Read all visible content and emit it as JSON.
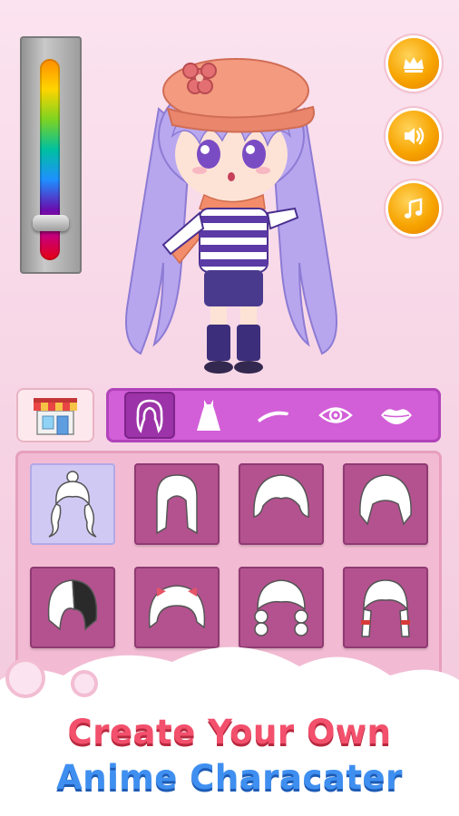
{
  "colors": {
    "accent_purple": "#d25ed8",
    "selected_tab": "#9c33a8",
    "item_tile": "#b4528f",
    "selected_item": "#cfc9f4",
    "headline_red": "#f2506c",
    "headline_blue": "#3f8ff0",
    "round_button_orange": "#f7a400"
  },
  "color_slider": {
    "level": 0.08
  },
  "side_buttons": [
    {
      "icon": "crown-icon"
    },
    {
      "icon": "sound-icon"
    },
    {
      "icon": "music-note-icon"
    }
  ],
  "shop": {
    "icon": "shop-icon"
  },
  "category_tabs": [
    {
      "icon": "hair-icon",
      "selected": true
    },
    {
      "icon": "dress-icon",
      "selected": false
    },
    {
      "icon": "eyebrow-icon",
      "selected": false
    },
    {
      "icon": "eye-icon",
      "selected": false
    },
    {
      "icon": "lips-icon",
      "selected": false
    }
  ],
  "hair_items": [
    {
      "icon": "hair-bun-twintails-icon",
      "selected": true
    },
    {
      "icon": "hair-straight-long-icon",
      "selected": false
    },
    {
      "icon": "hair-wide-bangs-icon",
      "selected": false
    },
    {
      "icon": "hair-bob-icon",
      "selected": false
    },
    {
      "icon": "hair-two-tone-icon",
      "selected": false
    },
    {
      "icon": "hair-bow-short-icon",
      "selected": false
    },
    {
      "icon": "hair-curly-icon",
      "selected": false
    },
    {
      "icon": "hair-red-tied-icon",
      "selected": false
    }
  ],
  "headline": {
    "line1": "Create Your Own",
    "line2": "Anime Characater"
  }
}
